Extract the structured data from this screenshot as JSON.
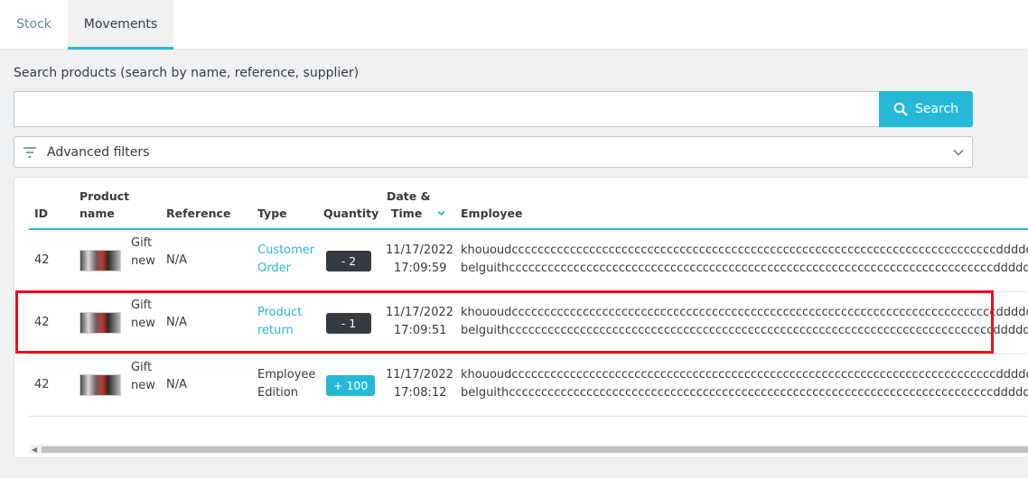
{
  "tabs": [
    {
      "label": "Stock",
      "active": false
    },
    {
      "label": "Movements",
      "active": true
    }
  ],
  "search": {
    "label": "Search products (search by name, reference, supplier)",
    "value": "",
    "placeholder": "",
    "button_label": "Search",
    "icon": "search-icon"
  },
  "filters": {
    "label": "Advanced filters",
    "icon": "filter-icon",
    "toggle_icon": "chevron-down-icon"
  },
  "table": {
    "headers": {
      "id": "ID",
      "product_name_1": "Product",
      "product_name_2": "name",
      "reference": "Reference",
      "type": "Type",
      "quantity": "Quantity",
      "date_1": "Date &",
      "date_2": "Time",
      "employee": "Employee"
    },
    "sort_icon": "chevron-down-icon",
    "rows": [
      {
        "id": "42",
        "product_line1": "Gift",
        "product_line2": "new",
        "reference": "N/A",
        "type_line1": "Customer",
        "type_line2": "Order",
        "type_is_link": true,
        "quantity": "- 2",
        "quantity_sign": "negative",
        "date": "11/17/2022",
        "time": "17:09:59",
        "employee_line1": "khououdcccccccccccccccccccccccccccccccccccccccccccccccccccccccccccccccccccccccccccdddddddddddd",
        "employee_line2": "belguithcccccccccccccccccccccccccccccccccccccccccccccccccccccccccccccccccccccccccccdddddd"
      },
      {
        "id": "42",
        "product_line1": "Gift",
        "product_line2": "new",
        "reference": "N/A",
        "type_line1": "Product",
        "type_line2": "return",
        "type_is_link": true,
        "quantity": "- 1",
        "quantity_sign": "negative",
        "date": "11/17/2022",
        "time": "17:09:51",
        "employee_line1": "khououdcccccccccccccccccccccccccccccccccccccccccccccccccccccccccccccccccccccccccccdddddddddddd",
        "employee_line2": "belguithcccccccccccccccccccccccccccccccccccccccccccccccccccccccccccccccccccccccccccdddddd"
      },
      {
        "id": "42",
        "product_line1": "Gift",
        "product_line2": "new",
        "reference": "N/A",
        "type_line1": "Employee",
        "type_line2": "Edition",
        "type_is_link": false,
        "quantity": "+ 100",
        "quantity_sign": "positive",
        "date": "11/17/2022",
        "time": "17:08:12",
        "employee_line1": "khououdcccccccccccccccccccccccccccccccccccccccccccccccccccccccccccccccccccccccccccdddddddddddd",
        "employee_line2": "belguithcccccccccccccccccccccccccccccccccccccccccccccccccccccccccccccccccccccccccccdddddd"
      }
    ]
  },
  "colors": {
    "accent": "#25b9d7",
    "dark_badge": "#363a41",
    "highlight": "#e8101a"
  }
}
